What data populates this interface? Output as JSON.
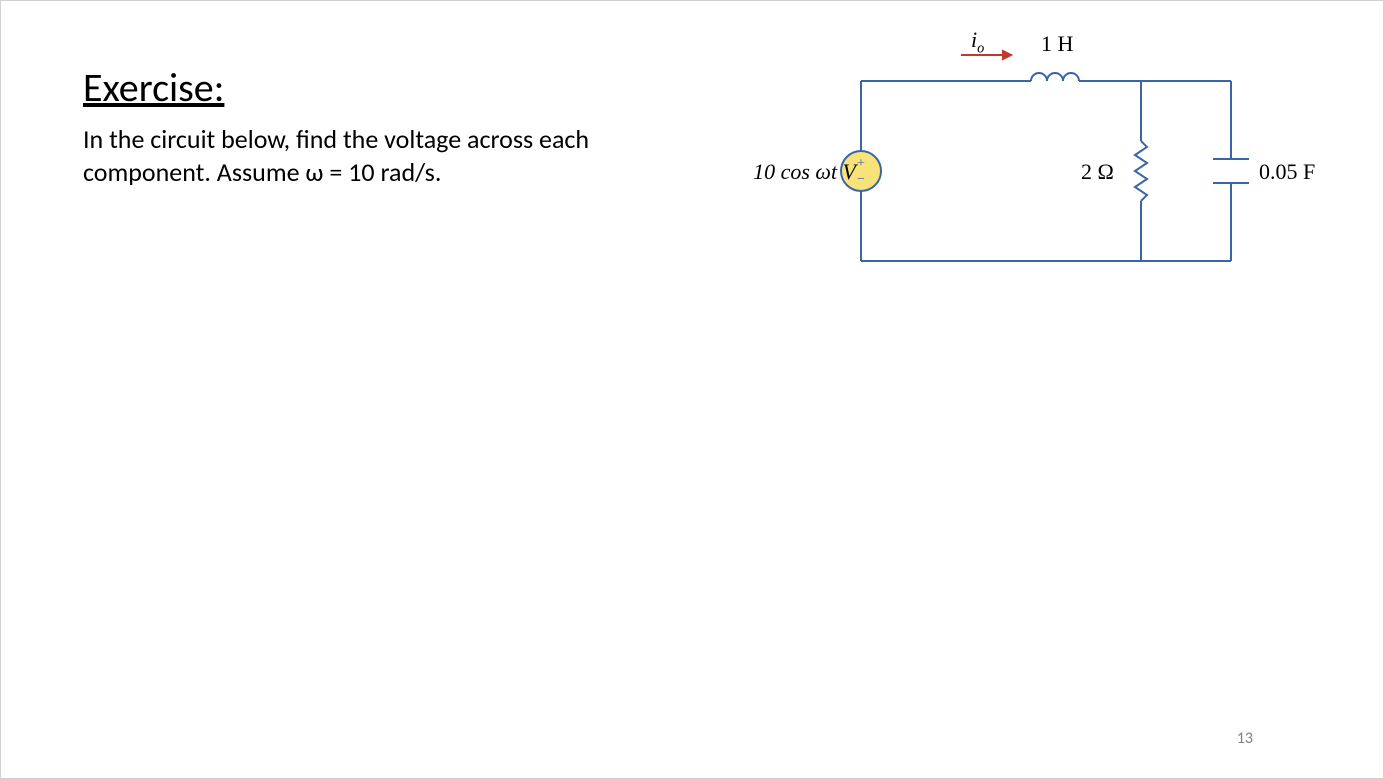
{
  "heading": "Exercise:",
  "body_line1": "In the circuit below, find the voltage across each",
  "body_line2": "component. Assume ω = 10 rad/s.",
  "page_number": "13",
  "circuit": {
    "source_label": "10 cos ωt V",
    "current_label_i": "i",
    "current_label_sub": "o",
    "inductor_label": "1 H",
    "resistor_label": "2 Ω",
    "capacitor_label": "0.05 F",
    "source_plus": "+",
    "source_minus": "−",
    "color_wire": "#3a66a8",
    "color_arrow": "#c0392b",
    "color_source_fill": "#f8e37b"
  }
}
